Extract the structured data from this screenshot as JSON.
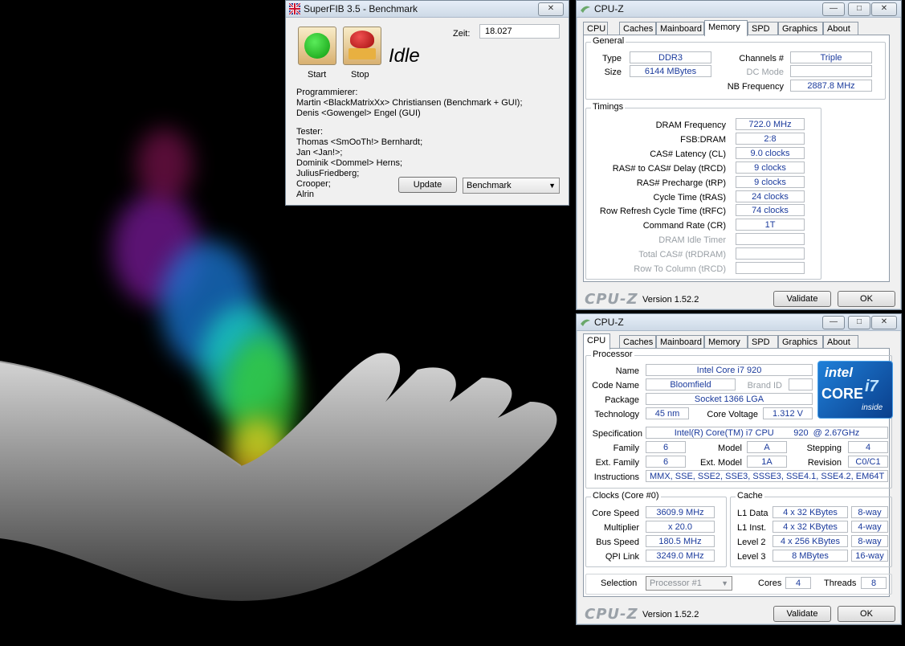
{
  "superfib": {
    "title": "SuperFIB 3.5 - Benchmark",
    "close": "✕",
    "zeit_label": "Zeit:",
    "zeit_value": "18.027",
    "start_label": "Start",
    "stop_label": "Stop",
    "status": "Idle",
    "programmer_heading": "Programmierer:",
    "programmers": [
      "Martin <BlackMatrixXx> Christiansen (Benchmark + GUI);",
      "Denis <Gowengel> Engel (GUI)"
    ],
    "tester_heading": "Tester:",
    "testers": [
      "Thomas <SmOoTh!> Bernhardt;",
      "Jan <Jan!>;",
      "Dominik <Dommel> Herns;",
      "JuliusFriedberg;",
      "Crooper;",
      "Alrin"
    ],
    "update_button": "Update",
    "mode_select": "Benchmark"
  },
  "cpuz_memory": {
    "title": "CPU-Z",
    "tabs": [
      "CPU",
      "Caches",
      "Mainboard",
      "Memory",
      "SPD",
      "Graphics",
      "About"
    ],
    "general_heading": "General",
    "type_label": "Type",
    "type_value": "DDR3",
    "size_label": "Size",
    "size_value": "6144 MBytes",
    "channels_label": "Channels #",
    "channels_value": "Triple",
    "dcmode_label": "DC Mode",
    "dcmode_value": "",
    "nbfreq_label": "NB Frequency",
    "nbfreq_value": "2887.8 MHz",
    "timings_heading": "Timings",
    "timings": [
      {
        "label": "DRAM Frequency",
        "value": "722.0 MHz",
        "enabled": true
      },
      {
        "label": "FSB:DRAM",
        "value": "2:8",
        "enabled": true
      },
      {
        "label": "CAS# Latency (CL)",
        "value": "9.0 clocks",
        "enabled": true
      },
      {
        "label": "RAS# to CAS# Delay (tRCD)",
        "value": "9 clocks",
        "enabled": true
      },
      {
        "label": "RAS# Precharge (tRP)",
        "value": "9 clocks",
        "enabled": true
      },
      {
        "label": "Cycle Time (tRAS)",
        "value": "24 clocks",
        "enabled": true
      },
      {
        "label": "Row Refresh Cycle Time (tRFC)",
        "value": "74 clocks",
        "enabled": true
      },
      {
        "label": "Command Rate (CR)",
        "value": "1T",
        "enabled": true
      },
      {
        "label": "DRAM Idle Timer",
        "value": "",
        "enabled": false
      },
      {
        "label": "Total CAS# (tRDRAM)",
        "value": "",
        "enabled": false
      },
      {
        "label": "Row To Column (tRCD)",
        "value": "",
        "enabled": false
      }
    ],
    "logo": "CPU-Z",
    "version": "Version 1.52.2",
    "validate": "Validate",
    "ok": "OK"
  },
  "cpuz_cpu": {
    "title": "CPU-Z",
    "tabs": [
      "CPU",
      "Caches",
      "Mainboard",
      "Memory",
      "SPD",
      "Graphics",
      "About"
    ],
    "processor_heading": "Processor",
    "name_label": "Name",
    "name_value": "Intel Core i7 920",
    "codename_label": "Code Name",
    "codename_value": "Bloomfield",
    "brandid_label": "Brand ID",
    "brandid_value": "",
    "package_label": "Package",
    "package_value": "Socket 1366 LGA",
    "technology_label": "Technology",
    "technology_value": "45 nm",
    "voltage_label": "Core Voltage",
    "voltage_value": "1.312 V",
    "spec_label": "Specification",
    "spec_value": "Intel(R) Core(TM) i7 CPU        920  @ 2.67GHz",
    "family_label": "Family",
    "family_value": "6",
    "model_label": "Model",
    "model_value": "A",
    "stepping_label": "Stepping",
    "stepping_value": "4",
    "extfamily_label": "Ext. Family",
    "extfamily_value": "6",
    "extmodel_label": "Ext. Model",
    "extmodel_value": "1A",
    "revision_label": "Revision",
    "revision_value": "C0/C1",
    "instructions_label": "Instructions",
    "instructions_value": "MMX, SSE, SSE2, SSE3, SSSE3, SSE4.1, SSE4.2, EM64T",
    "intel_brand": "intel",
    "intel_core": "CORE",
    "intel_i7": "i7",
    "intel_inside": "inside",
    "clocks_heading": "Clocks (Core #0)",
    "corespeed_label": "Core Speed",
    "corespeed_value": "3609.9 MHz",
    "multiplier_label": "Multiplier",
    "multiplier_value": "x 20.0",
    "busspeed_label": "Bus Speed",
    "busspeed_value": "180.5 MHz",
    "qpi_label": "QPI Link",
    "qpi_value": "3249.0 MHz",
    "cache_heading": "Cache",
    "cache": [
      {
        "label": "L1 Data",
        "size": "4 x 32 KBytes",
        "way": "8-way"
      },
      {
        "label": "L1 Inst.",
        "size": "4 x 32 KBytes",
        "way": "4-way"
      },
      {
        "label": "Level 2",
        "size": "4 x 256 KBytes",
        "way": "8-way"
      },
      {
        "label": "Level 3",
        "size": "8 MBytes",
        "way": "16-way"
      }
    ],
    "selection_label": "Selection",
    "selection_value": "Processor #1",
    "cores_label": "Cores",
    "cores_value": "4",
    "threads_label": "Threads",
    "threads_value": "8",
    "logo": "CPU-Z",
    "version": "Version 1.52.2",
    "validate": "Validate",
    "ok": "OK"
  },
  "window_buttons": {
    "minimize": "—",
    "maximize": "□",
    "close": "✕"
  }
}
